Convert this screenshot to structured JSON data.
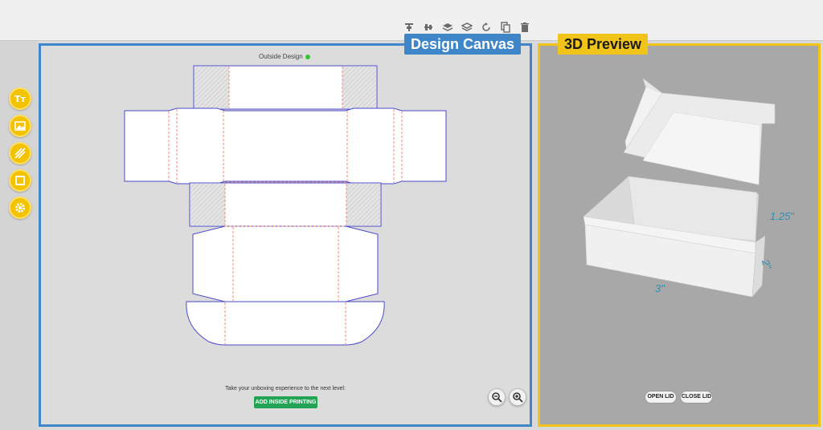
{
  "toolbar": {
    "icons": [
      "align-top-icon",
      "align-center-icon",
      "bring-forward-icon",
      "send-backward-icon",
      "rotate-icon",
      "duplicate-icon",
      "delete-icon"
    ]
  },
  "tags": {
    "design_canvas": "Design Canvas",
    "preview": "3D Preview"
  },
  "sidebar": {
    "tools": [
      "text-tool-icon",
      "image-tool-icon",
      "pattern-tool-icon",
      "shape-tool-icon",
      "settings-icon"
    ],
    "text_tool_glyph": "Tт"
  },
  "canvas": {
    "title": "Outside Design",
    "status_color": "#32c832",
    "tagline": "Take your unboxing experience to the next level:",
    "inside_button": "ADD INSIDE PRINTING"
  },
  "preview": {
    "dim_height": "1.25\"",
    "dim_depth": "2\"",
    "dim_width": "3\"",
    "open_button": "OPEN LID",
    "close_button": "CLOSE LID"
  },
  "colors": {
    "canvas_border": "#3f86c8",
    "preview_border": "#f0c419",
    "tool_yellow": "#f3c300",
    "cta_green": "#23a455",
    "cut_line": "#4a4ac8",
    "fold_line": "#f08a7a",
    "dimension_text": "#2f8fb3"
  }
}
